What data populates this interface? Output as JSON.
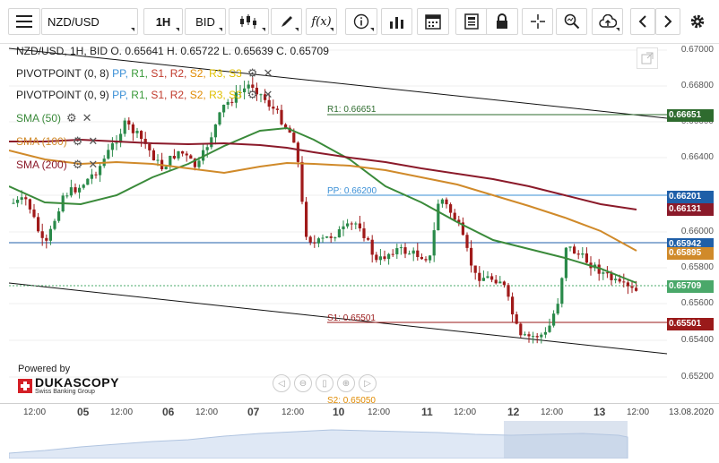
{
  "toolbar": {
    "symbol": "NZD/USD",
    "timeframe": "1H",
    "side": "BID"
  },
  "legend": {
    "ohlc": "NZD/USD, 1H, BID   O. 0.65641 H. 0.65722 L. 0.65639 C. 0.65709",
    "pivot1_label": "PIVOTPOINT (0, 8)",
    "pivot2_label": "PIVOTPOINT (0, 9)",
    "pp": "PP,",
    "r1": "R1,",
    "s1": "S1,",
    "r2": "R2,",
    "s2": "S2,",
    "r3": "R3,",
    "s3": "S3",
    "sma50": "SMA (50)",
    "sma100": "SMA (100)",
    "sma200": "SMA (200)"
  },
  "pivots": {
    "r1_text": "R1: 0.66651",
    "pp_text": "PP: 0.66200",
    "s1_text": "S1: 0.65501",
    "s2_text": "S2: 0.65050"
  },
  "branding": {
    "powered_by": "Powered by",
    "name": "DUKASCOPY",
    "tagline": "Swiss Banking Group"
  },
  "price_axis": {
    "ticks": [
      "0.67000",
      "0.66800",
      "0.66600",
      "0.66400",
      "0.66200",
      "0.66000",
      "0.65800",
      "0.65600",
      "0.65400",
      "0.65200"
    ],
    "labels": [
      {
        "text": "0.66651",
        "color": "#2e6b2e"
      },
      {
        "text": "0.66201",
        "color": "#1f5fa8"
      },
      {
        "text": "0.66131",
        "color": "#8b1a2a"
      },
      {
        "text": "0.65942",
        "color": "#1f5fa8"
      },
      {
        "text": "0.65895",
        "color": "#d08a2a"
      },
      {
        "text": "0.65709",
        "color": "#4aa86a"
      },
      {
        "text": "0.65501",
        "color": "#9a1a1a"
      }
    ]
  },
  "time_axis": {
    "ticks": [
      {
        "text": "12:00",
        "bold": false
      },
      {
        "text": "05",
        "bold": true
      },
      {
        "text": "12:00",
        "bold": false
      },
      {
        "text": "06",
        "bold": true
      },
      {
        "text": "12:00",
        "bold": false
      },
      {
        "text": "07",
        "bold": true
      },
      {
        "text": "12:00",
        "bold": false
      },
      {
        "text": "10",
        "bold": true
      },
      {
        "text": "12:00",
        "bold": false
      },
      {
        "text": "11",
        "bold": true
      },
      {
        "text": "12:00",
        "bold": false
      },
      {
        "text": "12",
        "bold": true
      },
      {
        "text": "12:00",
        "bold": false
      },
      {
        "text": "13",
        "bold": true
      },
      {
        "text": "12:00",
        "bold": false
      }
    ],
    "end_date": "13.08.2020"
  },
  "colors": {
    "up": "#2a8a4a",
    "down": "#a01a1a",
    "sma50": "#3a8a3a",
    "sma100": "#d08a2a",
    "sma200": "#8b1a2a",
    "r1": "#2e6b2e",
    "pp": "#1f5fa8",
    "s1": "#9a1a1a"
  }
}
